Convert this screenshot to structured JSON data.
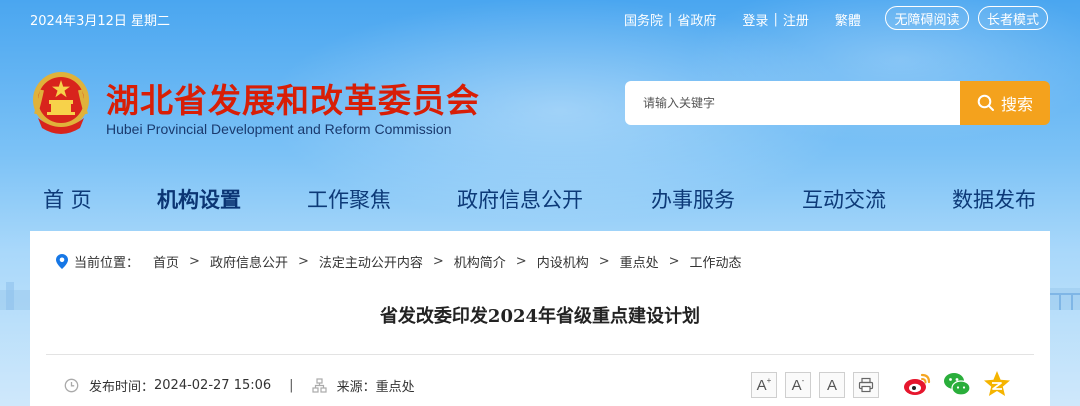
{
  "topbar": {
    "date": "2024年3月12日 星期二",
    "links": [
      "国务院",
      "省政府"
    ],
    "link_sep": "|",
    "auth": [
      "登录",
      "注册"
    ],
    "traditional": "繁體",
    "accessible": "无障碍阅读",
    "elder_mode": "长者模式"
  },
  "header": {
    "title": "湖北省发展和改革委员会",
    "subtitle": "Hubei Provincial Development and Reform Commission",
    "search_placeholder": "请输入关键字",
    "search_button": "搜索"
  },
  "nav": {
    "items": [
      "首 页",
      "机构设置",
      "工作聚焦",
      "政府信息公开",
      "办事服务",
      "互动交流",
      "数据发布"
    ],
    "active_index": 1
  },
  "breadcrumb": {
    "label": "当前位置：",
    "items": [
      "首页",
      "政府信息公开",
      "法定主动公开内容",
      "机构简介",
      "内设机构",
      "重点处",
      "工作动态"
    ],
    "separator": ">"
  },
  "article": {
    "title": "省发改委印发2024年省级重点建设计划",
    "published_label": "发布时间：",
    "published": "2024-02-27 15:06",
    "meta_sep": "|",
    "source_label": "来源：",
    "source": "重点处"
  },
  "tools": {
    "font_large": "A",
    "font_plus": "+",
    "font_medium": "A",
    "font_minus": "-",
    "font_normal": "A"
  },
  "colors": {
    "brand_red": "#d81e06",
    "nav_blue": "#0d3a78",
    "search_orange": "#f4a21d"
  }
}
